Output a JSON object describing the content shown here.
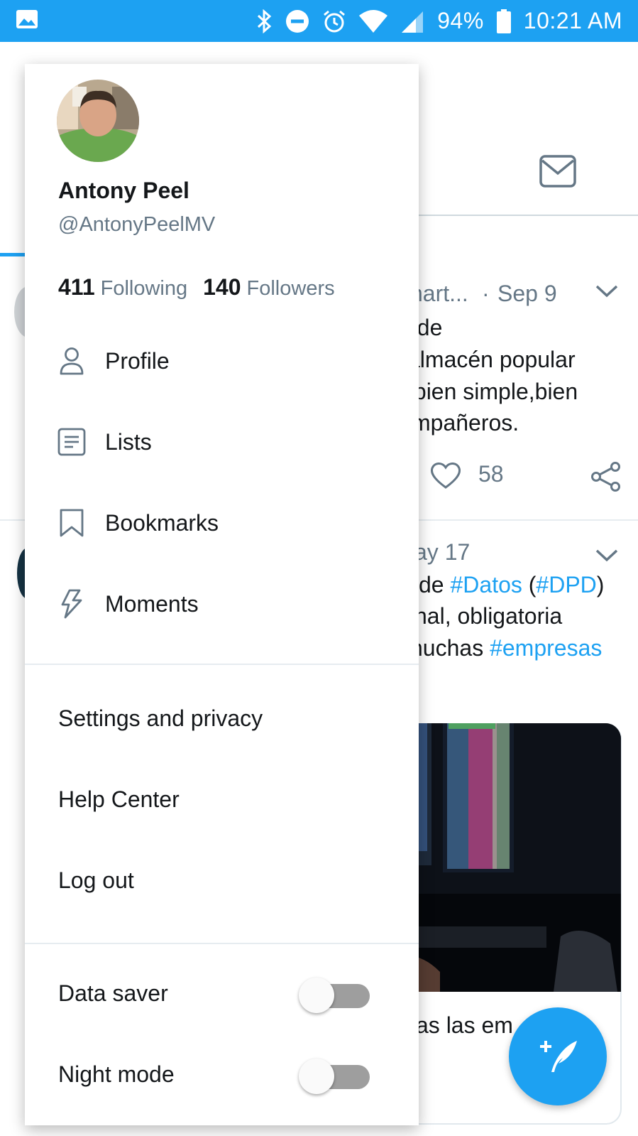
{
  "status_bar": {
    "battery": "94%",
    "time": "10:21 AM"
  },
  "profile": {
    "name": "Antony Peel",
    "handle": "@AntonyPeelMV",
    "following_count": "411",
    "following_label": "Following",
    "followers_count": "140",
    "followers_label": "Followers"
  },
  "menu": {
    "items": [
      {
        "label": "Profile",
        "icon": "person-icon"
      },
      {
        "label": "Lists",
        "icon": "list-icon"
      },
      {
        "label": "Bookmarks",
        "icon": "bookmark-icon"
      },
      {
        "label": "Moments",
        "icon": "lightning-icon"
      }
    ],
    "settings": "Settings and privacy",
    "help": "Help Center",
    "logout": "Log out",
    "data_saver": "Data saver",
    "night_mode": "Night mode",
    "data_saver_on": false,
    "night_mode_on": false
  },
  "feed": {
    "tweet1": {
      "author_fragment": "nart...",
      "date_sep": "·",
      "date": "Sep 9",
      "lines": [
        "; de",
        "almacén popular",
        ".bien simple,bien",
        "mpañeros."
      ],
      "like_count": "58"
    },
    "tweet2": {
      "date": "ay 17",
      "line1_pre": "de ",
      "line1_tag1": "#Datos",
      "line1_mid": " (",
      "line1_tag2": "#DPD",
      "line1_post": ")",
      "line2": "nal, obligatoria",
      "line3_pre": "nuchas ",
      "line3_tag": "#empresas",
      "card_caption": "as las em"
    }
  },
  "colors": {
    "brand": "#1da1f2",
    "text": "#14171a",
    "secondary": "#657786"
  }
}
